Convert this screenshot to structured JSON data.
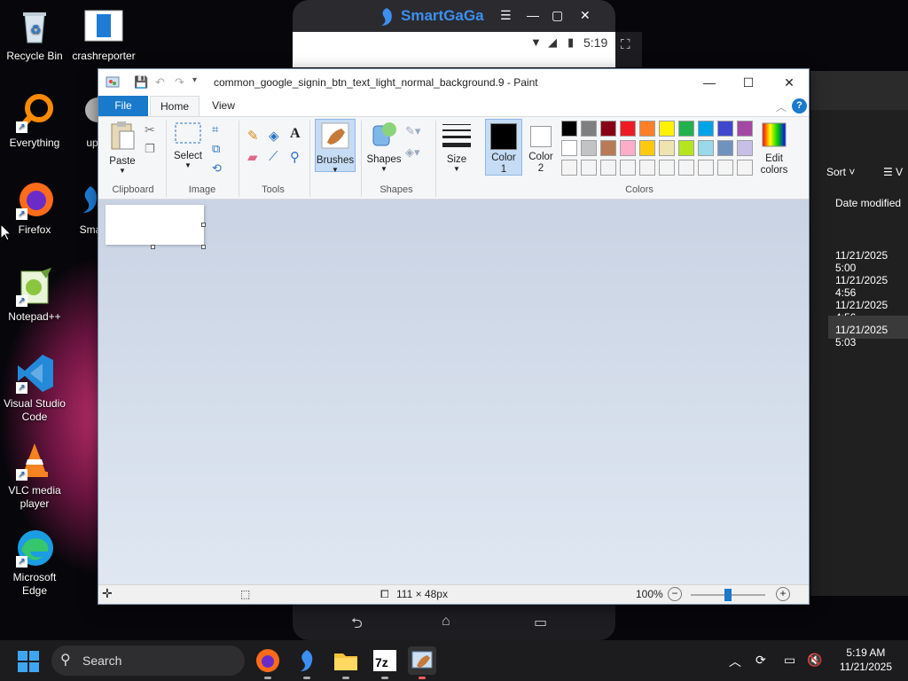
{
  "desktop": {
    "icons": [
      {
        "label": "Recycle Bin"
      },
      {
        "label": "crashreporter"
      },
      {
        "label": "Everything"
      },
      {
        "label": "up"
      },
      {
        "label": "Firefox"
      },
      {
        "label": "Sma"
      },
      {
        "label": "Notepad++"
      },
      {
        "label": "Visual Studio Code"
      },
      {
        "label": "VLC media player"
      },
      {
        "label": "Microsoft Edge"
      }
    ]
  },
  "emulator": {
    "brand": "SmartGaGa",
    "status_time": "5:19"
  },
  "explorer": {
    "sort_label": "Sort",
    "column_header": "Date modified",
    "rows": [
      "11/21/2025 5:00",
      "11/21/2025 4:56",
      "11/21/2025 4:56",
      "11/21/2025 5:03"
    ]
  },
  "paint": {
    "title": "common_google_signin_btn_text_light_normal_background.9 - Paint",
    "tabs": {
      "file": "File",
      "home": "Home",
      "view": "View"
    },
    "ribbon": {
      "paste": "Paste",
      "clipboard": "Clipboard",
      "select": "Select",
      "image": "Image",
      "tools": "Tools",
      "brushes": "Brushes",
      "shapes_btn": "Shapes",
      "shapes_group": "Shapes",
      "size": "Size",
      "color1": "Color\n1",
      "color1_a": "Color",
      "color1_b": "1",
      "color2_a": "Color",
      "color2_b": "2",
      "colors": "Colors",
      "edit_colors_a": "Edit",
      "edit_colors_b": "colors"
    },
    "palette_row1": [
      "#000000",
      "#7f7f7f",
      "#880015",
      "#ed1c24",
      "#ff7f27",
      "#fff200",
      "#22b14c",
      "#00a2e8",
      "#3f48cc",
      "#a349a4"
    ],
    "palette_row2": [
      "#ffffff",
      "#c3c3c3",
      "#b97a57",
      "#ffaec9",
      "#ffc90e",
      "#efe4b0",
      "#b5e61d",
      "#99d9ea",
      "#7092be",
      "#c8bfe7"
    ],
    "status": {
      "dimensions": "111 × 48px",
      "zoom": "100%"
    }
  },
  "taskbar": {
    "search_label": "Search",
    "time": "5:19 AM",
    "date": "11/21/2025"
  }
}
